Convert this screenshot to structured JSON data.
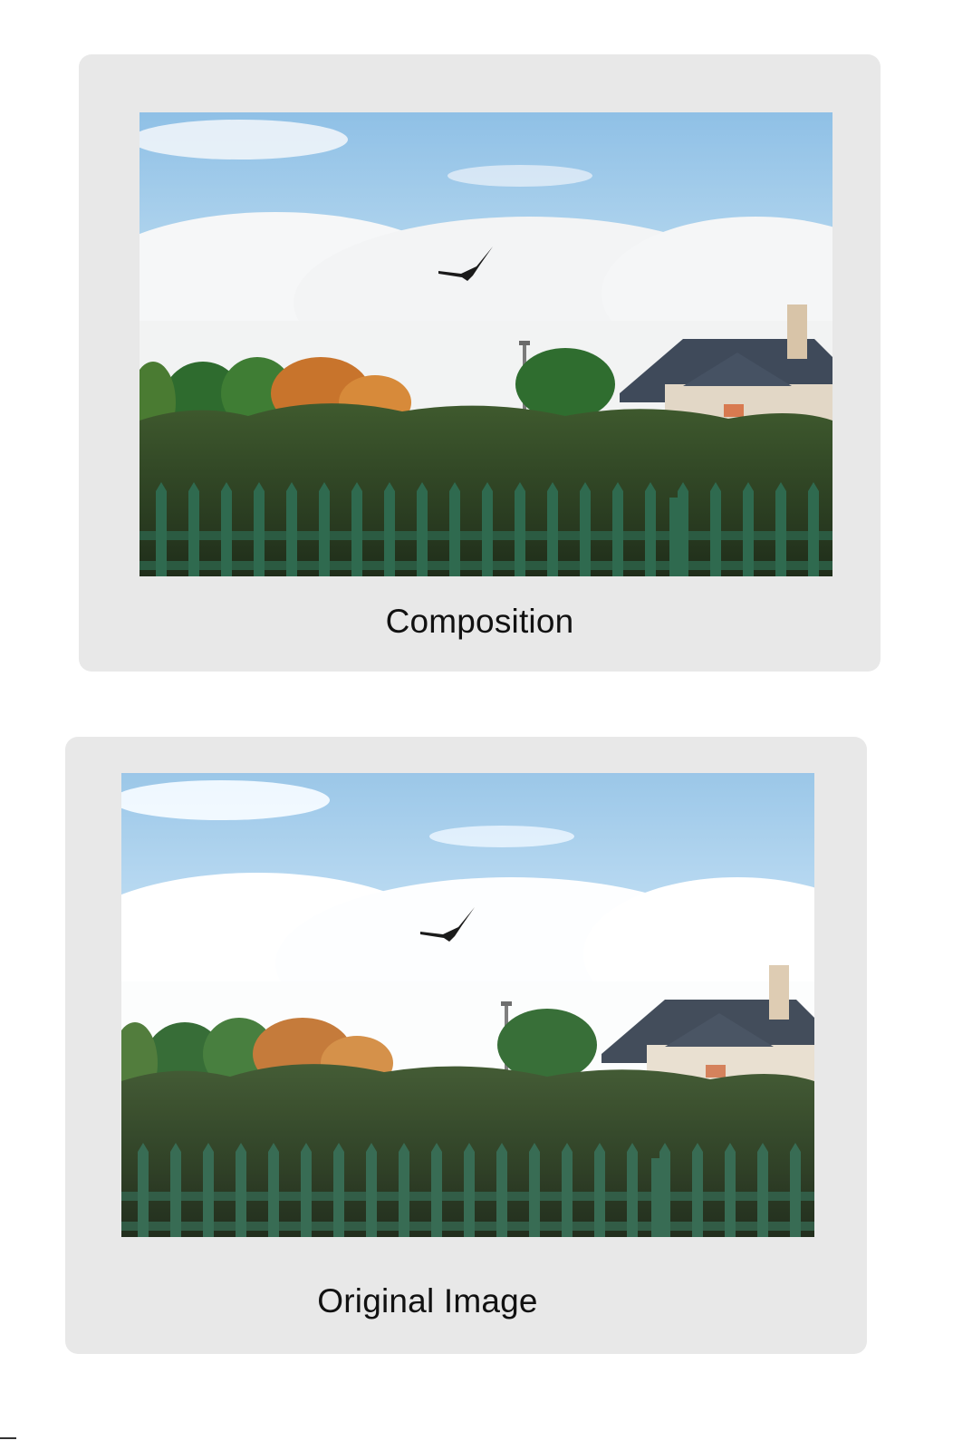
{
  "panels": [
    {
      "id": "composition",
      "caption": "Composition"
    },
    {
      "id": "original",
      "caption": "Original Image"
    }
  ],
  "colors": {
    "card_background": "#e8e8e8",
    "caption_text": "#111111",
    "sky": "#a9d0ec",
    "fence": "#2f6a4f",
    "roof": "#3f4a5a"
  }
}
